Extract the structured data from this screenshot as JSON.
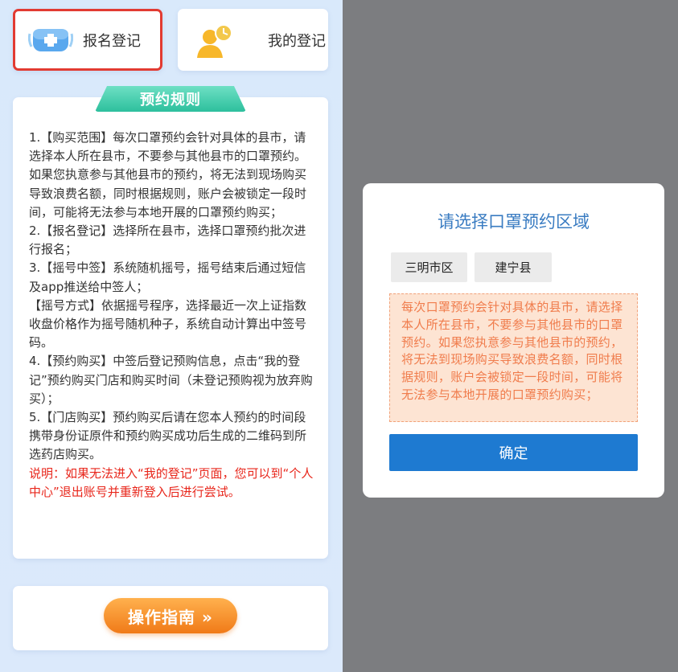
{
  "left": {
    "register_card": {
      "label": "报名登记",
      "icon": "mask-icon"
    },
    "mine_card": {
      "label": "我的登记",
      "icon": "user-clock-icon"
    },
    "rules": {
      "title": "预约规则",
      "paragraphs": [
        "1.【购买范围】每次口罩预约会针对具体的县市，请选择本人所在县市，不要参与其他县市的口罩预约。如果您执意参与其他县市的预约，将无法到现场购买导致浪费名额，同时根据规则，账户会被锁定一段时间，可能将无法参与本地开展的口罩预约购买；",
        "2.【报名登记】选择所在县市，选择口罩预约批次进行报名；",
        "3.【摇号中签】系统随机摇号，摇号结束后通过短信及app推送给中签人；",
        "【摇号方式】依据摇号程序，选择最近一次上证指数收盘价格作为摇号随机种子，系统自动计算出中签号码。",
        "4.【预约购买】中签后登记预购信息，点击“我的登记”预约购买门店和购买时间（未登记预购视为放弃购买）；",
        "5.【门店购买】预约购买后请在您本人预约的时间段携带身份证原件和预约购买成功后生成的二维码到所选药店购买。"
      ],
      "note": "说明：如果无法进入“我的登记”页面，您可以到“个人中心”退出账号并重新登入后进行尝试。"
    },
    "guide_button": "操作指南 »"
  },
  "dialog": {
    "title": "请选择口罩预约区域",
    "regions": [
      "三明市区",
      "建宁县"
    ],
    "notice": "每次口罩预约会针对具体的县市，请选择本人所在县市，不要参与其他县市的口罩预约。如果您执意参与其他县市的预约，将无法到现场购买导致浪费名额，同时根据规则，账户会被锁定一段时间，可能将无法参与本地开展的口罩预约购买；",
    "confirm": "确定"
  },
  "colors": {
    "highlight_border": "#e23b32",
    "accent_blue": "#1e7ad1",
    "ribbon_green": "#2dbf9d",
    "guide_orange": "#f07a18",
    "note_red": "#e8261b",
    "notice_bg": "#fde4d3"
  }
}
